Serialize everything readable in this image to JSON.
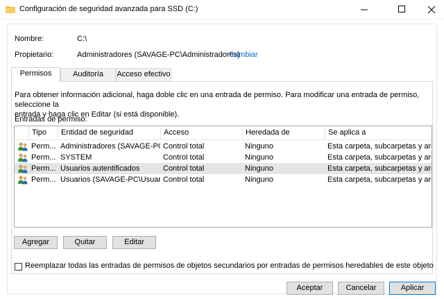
{
  "window": {
    "title": "Configuración de seguridad avanzada para SSD (C:)"
  },
  "fields": {
    "nombre_label": "Nombre:",
    "nombre_value": "C:\\",
    "propietario_label": "Propietario:",
    "propietario_value": "Administradores (SAVAGE-PC\\Administradores)",
    "cambiar_link": "Cambiar"
  },
  "tabs": [
    {
      "label": "Permisos",
      "active": true
    },
    {
      "label": "Auditoría",
      "active": false
    },
    {
      "label": "Acceso efectivo",
      "active": false
    }
  ],
  "info_text_line1": "Para obtener información adicional, haga doble clic en una entrada de permiso. Para modificar una entrada de permiso, seleccione la",
  "info_text_line2": "entrada y haga clic en Editar (si está disponible).",
  "entries_label": "Entradas de permiso:",
  "columns": [
    "Tipo",
    "Entidad de seguridad",
    "Acceso",
    "Heredada de",
    "Se aplica a"
  ],
  "rows": [
    {
      "tipo": "Perm...",
      "entidad": "Administradores (SAVAGE-PC...",
      "acceso": "Control total",
      "heredada": "Ninguno",
      "aplica": "Esta carpeta, subcarpetas y arc...",
      "selected": false
    },
    {
      "tipo": "Perm...",
      "entidad": "SYSTEM",
      "acceso": "Control total",
      "heredada": "Ninguno",
      "aplica": "Esta carpeta, subcarpetas y arc...",
      "selected": false
    },
    {
      "tipo": "Perm...",
      "entidad": "Usuarios autentificados",
      "acceso": "Control total",
      "heredada": "Ninguno",
      "aplica": "Esta carpeta, subcarpetas y arc...",
      "selected": true
    },
    {
      "tipo": "Perm...",
      "entidad": "Usuarios (SAVAGE-PC\\Usuarios)",
      "acceso": "Control total",
      "heredada": "Ninguno",
      "aplica": "Esta carpeta, subcarpetas y arc...",
      "selected": false
    }
  ],
  "buttons": {
    "agregar": "Agregar",
    "quitar": "Quitar",
    "editar": "Editar",
    "aceptar": "Aceptar",
    "cancelar": "Cancelar",
    "aplicar": "Aplicar"
  },
  "checkbox_label": "Reemplazar todas las entradas de permisos de objetos secundarios por entradas de permisos heredables de este objeto",
  "colors": {
    "link": "#0066cc",
    "selected_row": "#e5e5e5",
    "default_button_border": "#0078d7"
  },
  "icons": {
    "title": "folder-icon",
    "row": "users-icon"
  }
}
